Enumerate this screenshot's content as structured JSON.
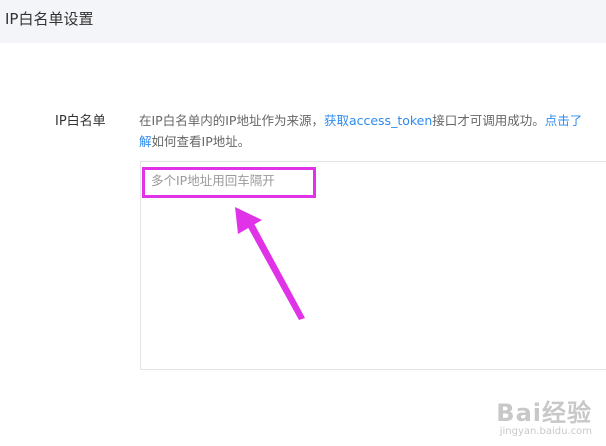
{
  "header": {
    "title": "IP白名单设置"
  },
  "form": {
    "label": "IP白名单",
    "description": {
      "part1": "在IP白名单内的IP地址作为来源，",
      "link1": "获取access_token",
      "part2": "接口才可调用成功。",
      "link2a": "点击了",
      "link2b": "解",
      "part3": "如何查看IP地址。"
    },
    "textarea": {
      "value": "",
      "placeholder": "多个IP地址用回车隔开"
    }
  },
  "annotation": {
    "highlight_color": "#e033e8"
  },
  "watermark": {
    "logo": "Bai经验",
    "url": "jingyan.baidu.com"
  },
  "colors": {
    "link": "#2d8cf0",
    "header_bg": "#f4f5f9"
  }
}
